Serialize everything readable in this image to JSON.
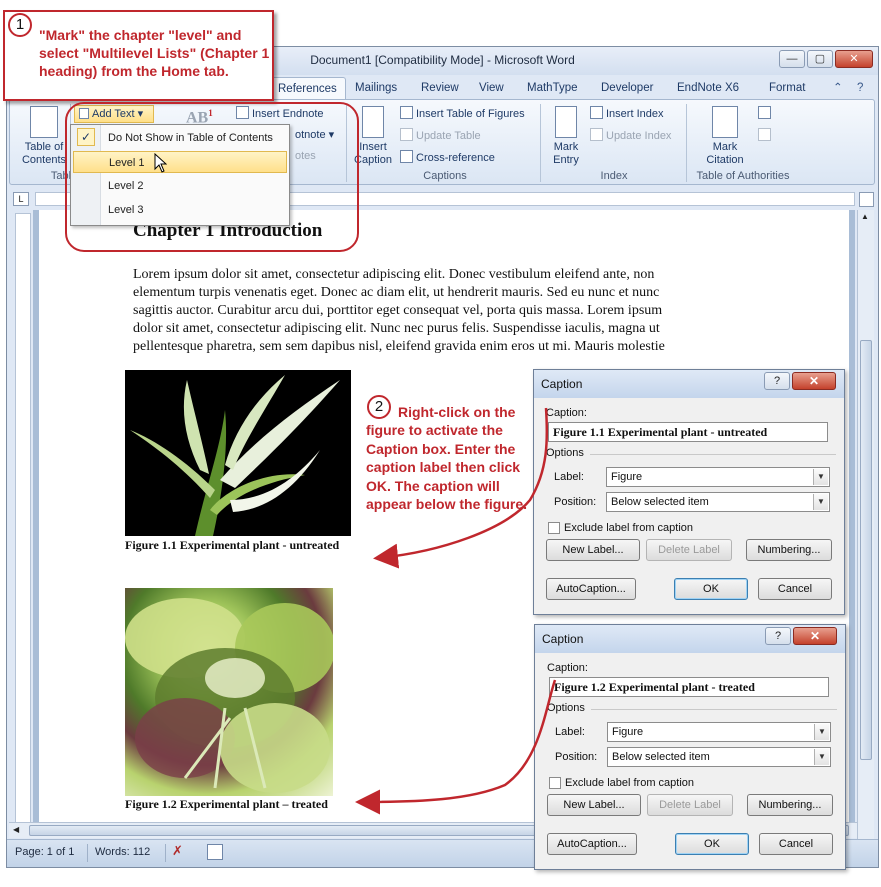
{
  "window": {
    "title": "Document1 [Compatibility Mode] - Microsoft Word",
    "min_symbol": "—",
    "max_symbol": "▢",
    "close_symbol": "✕"
  },
  "tabs": [
    "References",
    "Mailings",
    "Review",
    "View",
    "MathType",
    "Developer",
    "EndNote X6",
    "Format"
  ],
  "ribbon": {
    "add_text": "Add Text",
    "toc_line1": "Table of",
    "toc_line2": "Contents",
    "toc_group_partial": "Table",
    "insert_endnote": "Insert Endnote",
    "next_footnote_partial": "otnote",
    "footnotes_partial": "otes",
    "insert_caption_line1": "Insert",
    "insert_caption_line2": "Caption",
    "insert_table_of_figures": "Insert Table of Figures",
    "update_table": "Update Table",
    "cross_reference": "Cross-reference",
    "captions_group": "Captions",
    "mark_entry_line1": "Mark",
    "mark_entry_line2": "Entry",
    "insert_index": "Insert Index",
    "update_index": "Update Index",
    "index_group": "Index",
    "mark_citation_line1": "Mark",
    "mark_citation_line2": "Citation",
    "toa_group": "Table of Authorities"
  },
  "dropdown": {
    "items": [
      "Do Not Show in Table of Contents",
      "Level 1",
      "Level 2",
      "Level 3"
    ],
    "checked_index": 0,
    "highlighted_index": 1
  },
  "document": {
    "heading": "Chapter 1 Introduction",
    "body_lines": [
      "Lorem ipsum dolor sit amet, consectetur adipiscing elit. Donec vestibulum eleifend ante, non",
      "elementum turpis venenatis eget. Donec ac diam elit, ut hendrerit mauris. Sed eu nunc et nunc",
      "sagittis auctor. Curabitur arcu dui, porttitor eget consequat vel, porta quis massa. Lorem ipsum",
      "dolor sit amet, consectetur adipiscing elit. Nunc nec purus felis. Suspendisse iaculis, magna ut",
      "pellentesque pharetra, sem sem dapibus nisl, eleifend gravida enim eros ut mi. Mauris molestie"
    ],
    "figure1_caption": "Figure 1.1 Experimental plant - untreated",
    "figure2_caption": "Figure 1.2 Experimental plant – treated"
  },
  "callouts": {
    "one_number": "1",
    "one_text": "\"Mark\" the chapter \"level\" and select \"Multilevel Lists\" (Chapter 1 heading) from the Home tab.",
    "two_number": "2",
    "two_text": "Right-click on the figure to activate the Caption box. Enter the caption label then click OK. The caption will appear below the figure."
  },
  "dialogs": [
    {
      "title": "Caption",
      "help": "?",
      "close": "✕",
      "caption_label": "Caption:",
      "caption_value": "Figure 1.1 Experimental plant - untreated",
      "options_label": "Options",
      "label_label": "Label:",
      "label_value": "Figure",
      "position_label": "Position:",
      "position_value": "Below selected item",
      "exclude_label": "Exclude label from caption",
      "new_label": "New Label...",
      "delete_label": "Delete Label",
      "numbering": "Numbering...",
      "autocaption": "AutoCaption...",
      "ok": "OK",
      "cancel": "Cancel"
    },
    {
      "title": "Caption",
      "help": "?",
      "close": "✕",
      "caption_label": "Caption:",
      "caption_value": "Figure 1.2 Experimental plant - treated",
      "options_label": "Options",
      "label_label": "Label:",
      "label_value": "Figure",
      "position_label": "Position:",
      "position_value": "Below selected item",
      "exclude_label": "Exclude label from caption",
      "new_label": "New Label...",
      "delete_label": "Delete Label",
      "numbering": "Numbering...",
      "autocaption": "AutoCaption...",
      "ok": "OK",
      "cancel": "Cancel"
    }
  ],
  "status": {
    "page": "Page: 1 of 1",
    "words": "Words: 112"
  },
  "colors": {
    "callout_red": "#c0272d",
    "ribbon_blue": "#dfe8f5",
    "highlight_yellow": "#ffe08a"
  }
}
